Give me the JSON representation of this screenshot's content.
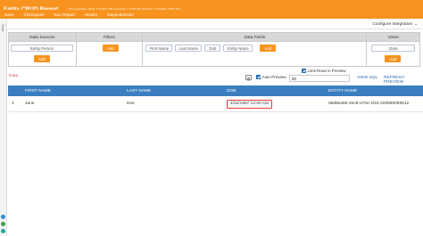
{
  "header": {
    "title": "Entity CRUD Report",
    "breadcrumb": "[ Examples 404 / Data Structures / CRUD Action / Entity CRUD ]"
  },
  "menu": [
    "Save",
    "Checkpoint",
    "Run Report",
    "History",
    "Dependencies"
  ],
  "subbar": {
    "configure_integration": "Configure Integration"
  },
  "left_strip": {
    "label": "Tools"
  },
  "config": {
    "columns": [
      "Data Sources",
      "Filters",
      "Data Fields",
      "Views"
    ],
    "data_source_chip": "Entity Person",
    "data_fields": [
      "First Name",
      "Last Name",
      "Dob",
      "Entity Name"
    ],
    "views_chip": "Data",
    "add_label": "Add"
  },
  "toolbar": {
    "data_label": "Data",
    "limit_rows_label": "Limit Rows in Preview",
    "auto_preview_label": "Auto Preview",
    "limit_value": "50",
    "view_sql": "VIEW SQL",
    "refresh_preview": "REFRESH PREVIEW"
  },
  "grid": {
    "headers": [
      "",
      "FIRST NAME",
      "LAST NAME",
      "DOB",
      "ENTITY NAME"
    ],
    "rows": [
      [
        "1",
        "Jane",
        "Doe",
        "4/22/1997 12:00 AM",
        "08d9ea50-2ec8-e72e-1f24-220590053512"
      ]
    ]
  },
  "colors": {
    "accent": "#f7931e",
    "grid_header": "#3a7ec0",
    "link": "#2b6cb0",
    "highlight": "#e53935"
  }
}
